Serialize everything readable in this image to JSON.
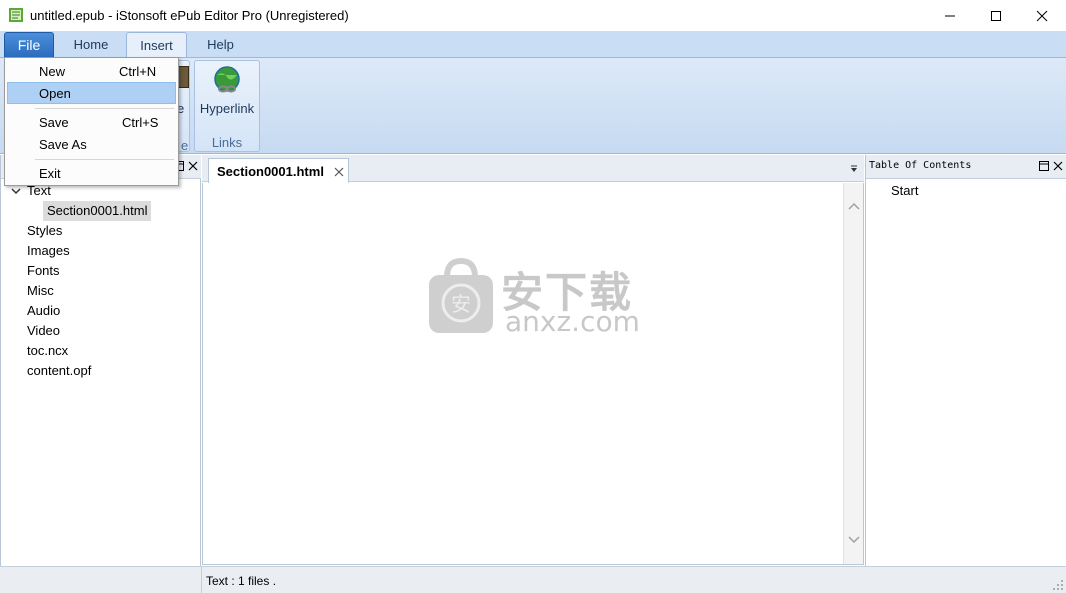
{
  "window": {
    "title": "untitled.epub - iStonsoft ePub Editor Pro (Unregistered)",
    "controls": [
      "minimize",
      "maximize",
      "close"
    ]
  },
  "menu_tabs": {
    "file": "File",
    "home": "Home",
    "insert": "Insert",
    "help": "Help"
  },
  "ribbon": {
    "hyperlink_label": "Hyperlink",
    "links_group": "Links",
    "partial_button_label": "e",
    "partial_group_label": "e"
  },
  "file_menu": {
    "items": [
      {
        "label": "New",
        "shortcut": "Ctrl+N"
      },
      {
        "label": "Open",
        "shortcut": ""
      },
      {
        "label": "Save",
        "shortcut": "Ctrl+S"
      },
      {
        "label": "Save As",
        "shortcut": ""
      },
      {
        "label": "Exit",
        "shortcut": ""
      }
    ]
  },
  "left_panel": {
    "tree": {
      "text": "Text",
      "text_child": "Section0001.html",
      "styles": "Styles",
      "images": "Images",
      "fonts": "Fonts",
      "misc": "Misc",
      "audio": "Audio",
      "video": "Video",
      "toc": "toc.ncx",
      "content": "content.opf"
    }
  },
  "editor": {
    "tab_label": "Section0001.html"
  },
  "watermark": {
    "cn": "安下载",
    "en": "anxz.com"
  },
  "right_panel": {
    "title": "Table Of Contents",
    "item": "Start"
  },
  "status": {
    "text": "Text : 1 files ."
  },
  "colors": {
    "file_tab": "#2b6cbf",
    "ribbon": "#c6daf1",
    "menu_highlight": "#aed0f5",
    "selected_tree_item": "#dcdcdc"
  }
}
